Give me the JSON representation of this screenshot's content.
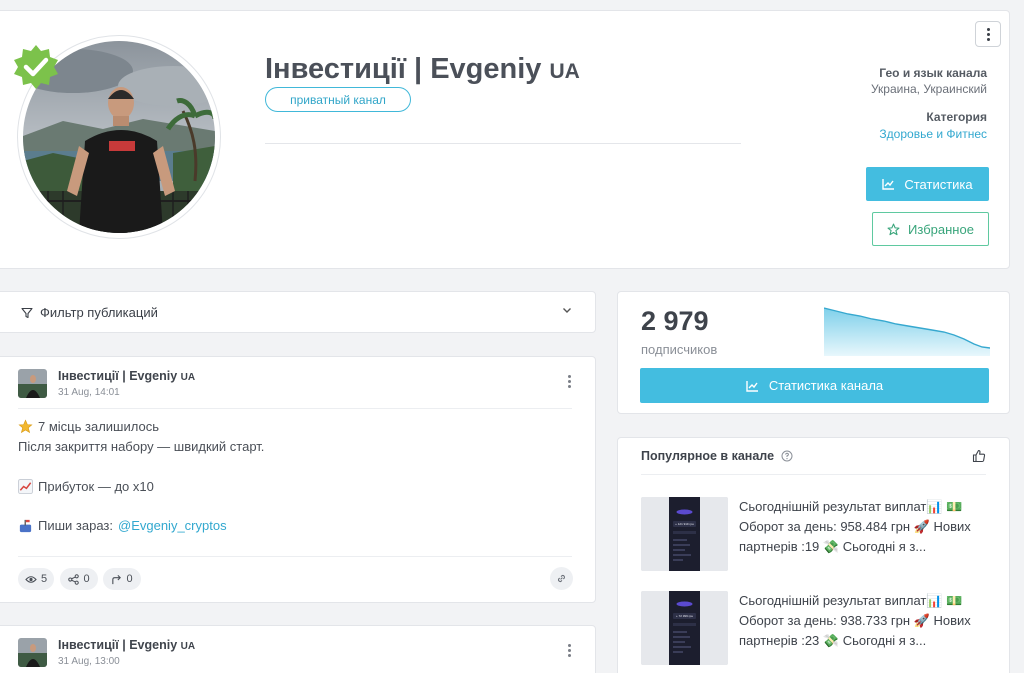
{
  "channel": {
    "title": "Інвестиції | Evgeniy",
    "title_suffix": "UA",
    "badge": "приватный канал",
    "geo_label": "Гео и язык канала",
    "geo_value": "Украина, Украинский",
    "category_label": "Категория",
    "category_value": "Здоровье и Фитнес",
    "stats_button": "Статистика",
    "favorite_button": "Избранное"
  },
  "filter": {
    "label": "Фильтр публикаций"
  },
  "posts": [
    {
      "author": "Інвестиції | Evgeniy",
      "author_suffix": "UA",
      "date": "31 Aug, 14:01",
      "lines": [
        "7 місць залишилось",
        "Після закриття набору — швидкий старт.",
        "Прибуток — до x10",
        "Пиши зараз:"
      ],
      "mention": "@Evgeniy_cryptos",
      "views": "5",
      "shares": "0",
      "forwards": "0"
    },
    {
      "author": "Інвестиції | Evgeniy",
      "author_suffix": "UA",
      "date": "31 Aug, 13:00"
    }
  ],
  "subscribers": {
    "count": "2 979",
    "label": "подписчиков",
    "button": "Статистика канала"
  },
  "popular": {
    "title": "Популярное в канале",
    "items": [
      {
        "line1": "Сьогоднішній результат виплат📊 💵",
        "line2": "Оборот за день: 958.484 грн 🚀 Нових",
        "line3": "партнерів :19 💸 Сьогодні я з...",
        "thumb_amount": "+ 121 919 грн"
      },
      {
        "line1": "Сьогоднішній результат виплат📊 💵",
        "line2": "Оборот за день: 938.733 грн 🚀 Нових",
        "line3": "партнерів :23 💸 Сьогодні я з...",
        "thumb_amount": "+ 72 399 грн"
      }
    ]
  },
  "colors": {
    "accent": "#43bde0",
    "favorite": "#5fc9a0",
    "verified": "#7cc24b",
    "link": "#32a8cf"
  }
}
